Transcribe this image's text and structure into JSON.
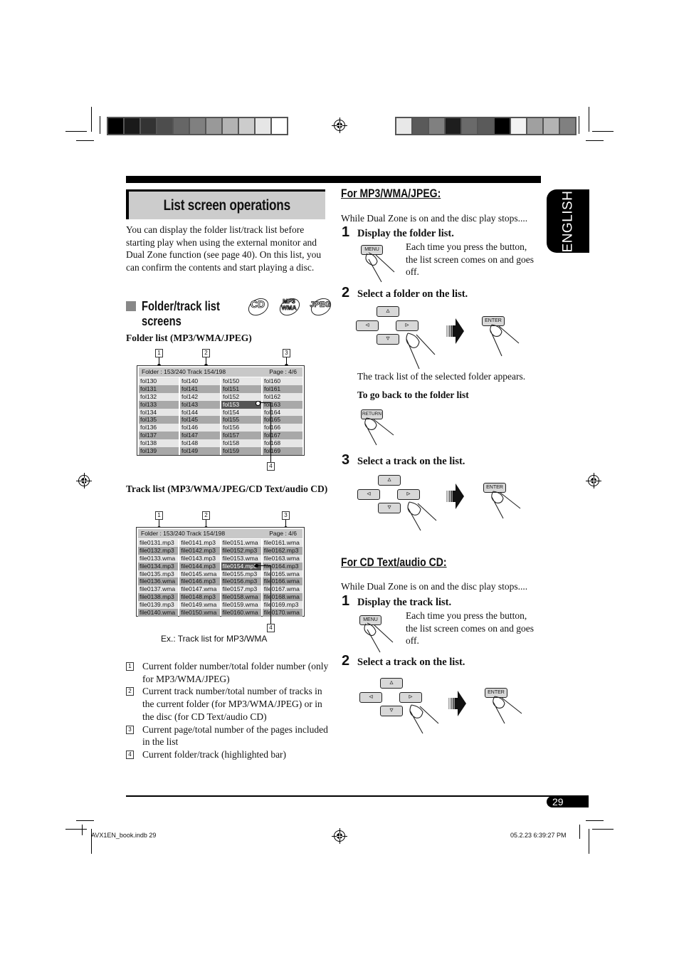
{
  "print_marks": {
    "colorbar_left": [
      "#000000",
      "#1a1a1a",
      "#333333",
      "#4d4d4d",
      "#666666",
      "#808080",
      "#999999",
      "#b3b3b3",
      "#cccccc",
      "#e6e6e6",
      "#ffffff"
    ],
    "colorbar_right": [
      "#e8e8e8",
      "#5a5a5a",
      "#808080",
      "#1e1e1e",
      "#6a6a6a",
      "#5a5a5a",
      "#000000",
      "#f2f2f2",
      "#a0a0a0",
      "#b4b4b4",
      "#808080"
    ]
  },
  "header": {
    "title": "List screen operations",
    "language_tab": "ENGLISH"
  },
  "intro": "You can display the folder list/track list before starting play when using the external monitor and Dual Zone function (see page 40). On this list, you can confirm the contents and start playing a disc.",
  "section": {
    "title_line1": "Folder/track list",
    "title_line2": "screens",
    "disc_icons": [
      {
        "name": "cd-icon",
        "label": "CD"
      },
      {
        "name": "mp3-wma-icon",
        "label": "MP3/WMA"
      },
      {
        "name": "jpeg-icon",
        "label": "JPEG"
      }
    ]
  },
  "folder_list": {
    "label": "Folder list (MP3/WMA/JPEG)",
    "header_left": "Folder : 153/240  Track 154/198",
    "header_right": "Page : 4/6",
    "callouts": [
      "1",
      "2",
      "3",
      "4"
    ],
    "columns": [
      [
        "fol130",
        "fol131",
        "fol132",
        "fol133",
        "fol134",
        "fol135",
        "fol136",
        "fol137",
        "fol138",
        "fol139"
      ],
      [
        "fol140",
        "fol141",
        "fol142",
        "fol143",
        "fol144",
        "fol145",
        "fol146",
        "fol147",
        "fol148",
        "fol149"
      ],
      [
        "fol150",
        "fol151",
        "fol152",
        "fol153",
        "fol154",
        "fol155",
        "fol156",
        "fol157",
        "fol158",
        "fol159"
      ],
      [
        "fol160",
        "fol161",
        "fol162",
        "fol163",
        "fol164",
        "fol165",
        "fol166",
        "fol167",
        "fol168",
        "fol169"
      ]
    ],
    "highlighted": {
      "col": 2,
      "row": 3
    }
  },
  "track_list": {
    "label": "Track list (MP3/WMA/JPEG/CD Text/audio CD)",
    "header_left": "Folder : 153/240  Track 154/198",
    "header_right": "Page : 4/6",
    "callouts": [
      "1",
      "2",
      "3",
      "4"
    ],
    "columns": [
      [
        "file0131.mp3",
        "file0132.mp3",
        "file0133.wma",
        "file0134.mp3",
        "file0135.mp3",
        "file0136.wma",
        "file0137.wma",
        "file0138.mp3",
        "file0139.mp3",
        "file0140.wma"
      ],
      [
        "file0141.mp3",
        "file0142.mp3",
        "file0143.mp3",
        "file0144.mp3",
        "file0145.wma",
        "file0146.mp3",
        "file0147.wma",
        "file0148.mp3",
        "file0149.wma",
        "file0150.wma"
      ],
      [
        "file0151.wma",
        "file0152.mp3",
        "file0153.wma",
        "file0154.mp3",
        "file0155.mp3",
        "file0156.mp3",
        "file0157.mp3",
        "file0158.wma",
        "file0159.wma",
        "file0160.wma"
      ],
      [
        "file0161.wma",
        "file0162.mp3",
        "file0163.wma",
        "file0164.mp3",
        "file0165.wma",
        "file0166.wma",
        "file0167.wma",
        "file0168.wma",
        "file0169.mp3",
        "file0170.wma"
      ]
    ],
    "highlighted": {
      "col": 2,
      "row": 3
    },
    "caption": "Ex.: Track list for MP3/WMA"
  },
  "legend": [
    {
      "num": "1",
      "text": "Current folder number/total folder number (only for MP3/WMA/JPEG)"
    },
    {
      "num": "2",
      "text": "Current track number/total number of tracks in the current folder (for MP3/WMA/JPEG) or in the disc (for CD Text/audio CD)"
    },
    {
      "num": "3",
      "text": "Current page/total number of the pages included in the list"
    },
    {
      "num": "4",
      "text": "Current folder/track (highlighted bar)"
    }
  ],
  "mp3_section": {
    "heading": "For MP3/WMA/JPEG:",
    "lead": "While Dual Zone is on and the disc play stops....",
    "steps": [
      {
        "num": "1",
        "title": "Display the folder list.",
        "desc": "Each time you press the button, the list screen comes on and goes off.",
        "button": "MENU"
      },
      {
        "num": "2",
        "title": "Select a folder on the list.",
        "result": "The track list of the selected folder appears.",
        "button": "ENTER"
      },
      {
        "num": "3",
        "title": "Select a track on the list.",
        "button": "ENTER"
      }
    ],
    "back_label": "To go back to the folder list",
    "back_button": "RETURN"
  },
  "cd_section": {
    "heading": "For CD Text/audio CD:",
    "lead": "While Dual Zone is on and the disc play stops....",
    "steps": [
      {
        "num": "1",
        "title": "Display the track list.",
        "desc": "Each time you press the button, the list screen comes on and goes off.",
        "button": "MENU"
      },
      {
        "num": "2",
        "title": "Select a track on the list.",
        "button": "ENTER"
      }
    ]
  },
  "dpad": {
    "up": "▵",
    "down": "▿",
    "left": "◃",
    "right": "▹"
  },
  "footer": {
    "page_number": "29",
    "file_slug": "AVX1EN_book.indb   29",
    "timestamp": "05.2.23   6:39:27 PM"
  }
}
